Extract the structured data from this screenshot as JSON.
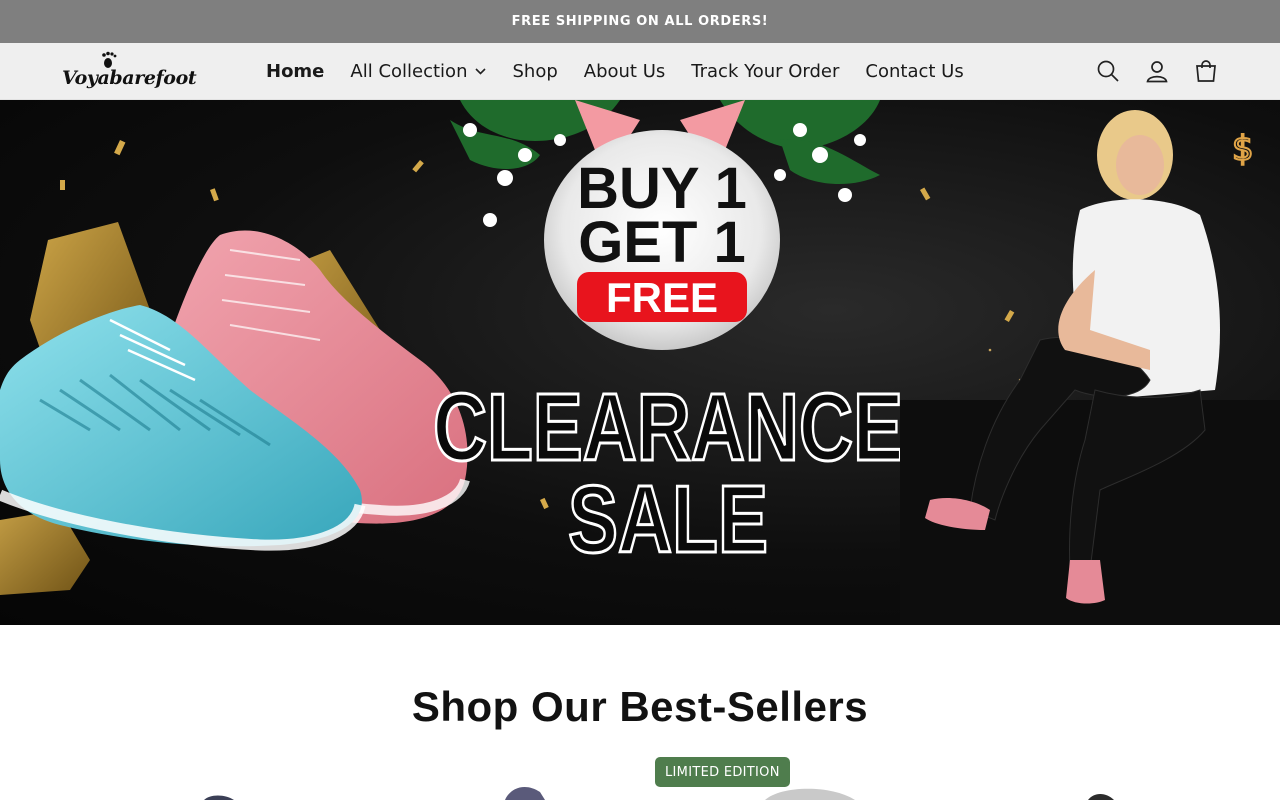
{
  "announcement": {
    "text": "FREE SHIPPING ON ALL ORDERS!"
  },
  "header": {
    "logo_text": "Voyabarefoot",
    "nav": [
      {
        "label": "Home",
        "active": true
      },
      {
        "label": "All Collection",
        "has_dropdown": true
      },
      {
        "label": "Shop"
      },
      {
        "label": "About Us"
      },
      {
        "label": "Track Your Order"
      },
      {
        "label": "Contact Us"
      }
    ],
    "icons": [
      "search-icon",
      "account-icon",
      "cart-icon"
    ]
  },
  "hero": {
    "headline_1": "BUY 1",
    "headline_2": "GET 1",
    "headline_3": "FREE",
    "headline_4": "CLEARANCE",
    "headline_5": "SALE"
  },
  "best_sellers": {
    "title": "Shop Our Best-Sellers",
    "badge": "LIMITED EDITION"
  },
  "colors": {
    "announcement_bg": "#7f7f7f",
    "header_bg": "#efefef",
    "badge_bg": "#4f7d4d",
    "free_red": "#e8141d",
    "shoe_pink": "#e58a97",
    "shoe_blue": "#5ec6d6"
  }
}
